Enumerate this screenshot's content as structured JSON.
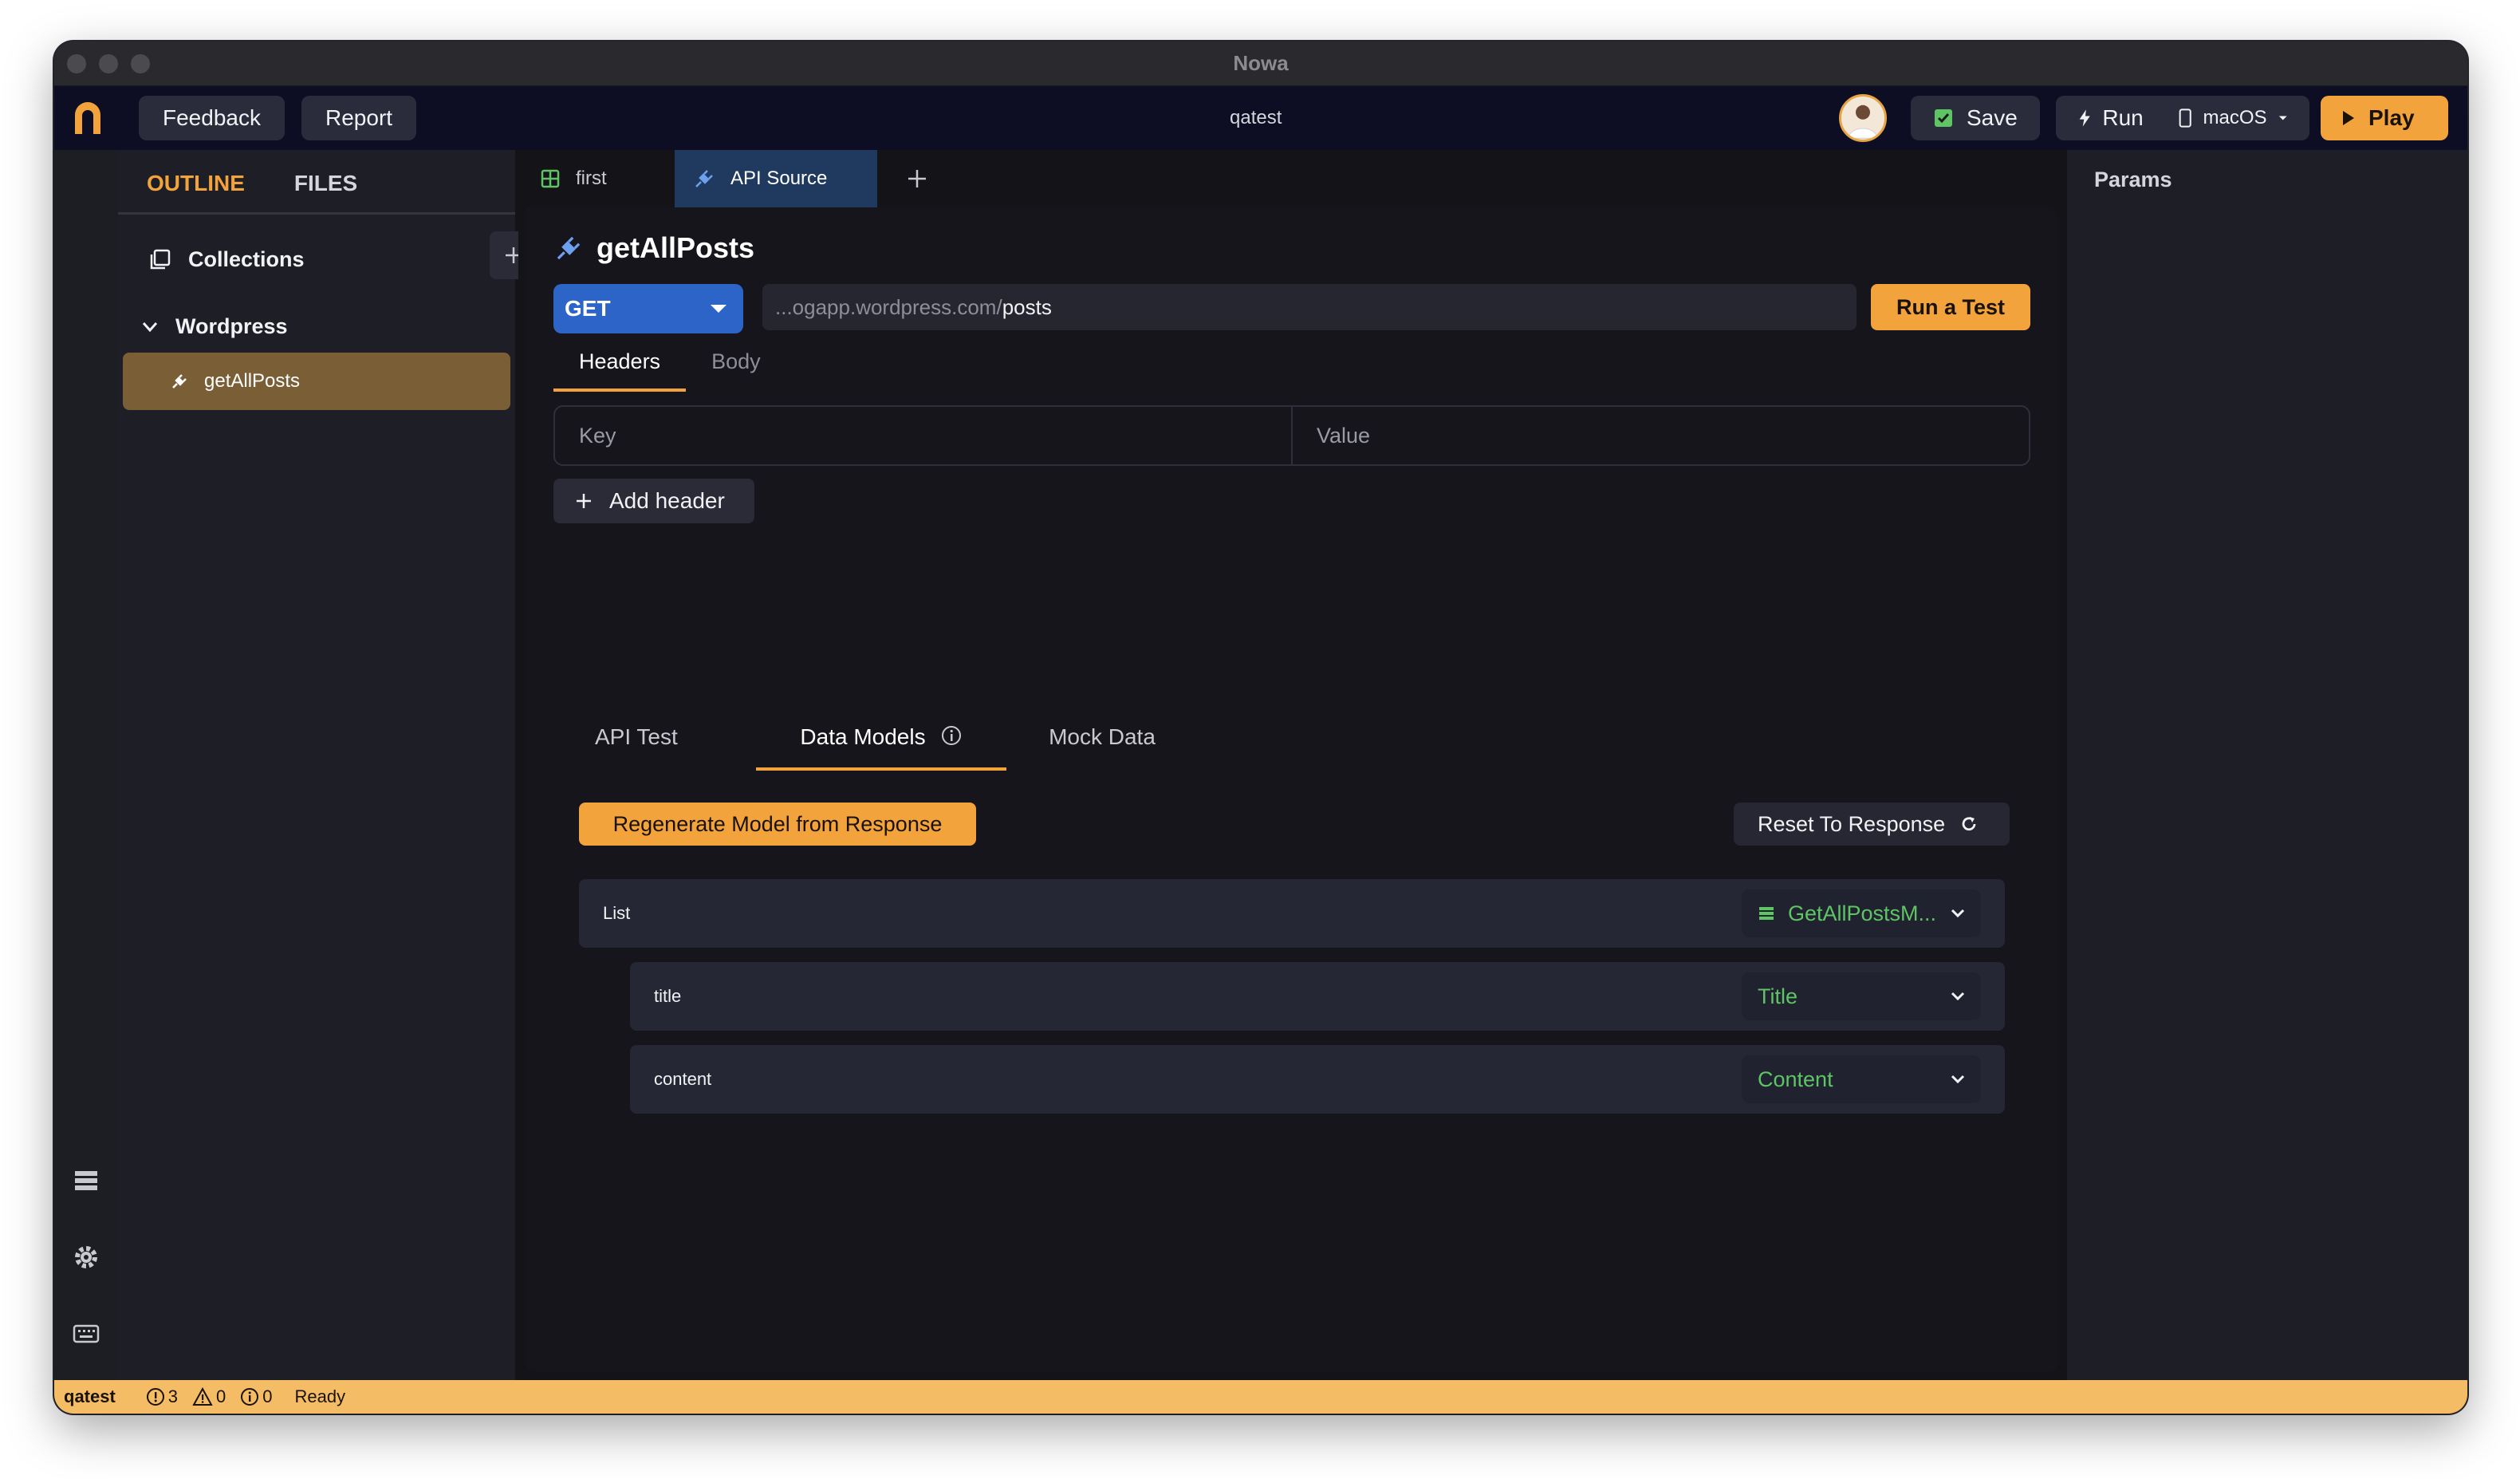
{
  "window": {
    "title": "Nowa"
  },
  "topbar": {
    "feedback_label": "Feedback",
    "report_label": "Report",
    "project_name": "qatest",
    "save_label": "Save",
    "run_label": "Run",
    "platform_label": "macOS",
    "play_label": "Play"
  },
  "sidebar": {
    "tabs": [
      "OUTLINE",
      "FILES"
    ],
    "collections_label": "Collections",
    "group_label": "Wordpress",
    "selected_item": "getAllPosts"
  },
  "editor_tabs": [
    {
      "label": "first",
      "icon": "grid-icon"
    },
    {
      "label": "API Source",
      "icon": "plug-icon"
    }
  ],
  "api": {
    "name": "getAllPosts",
    "method": "GET",
    "url_prefix": "...ogapp.wordpress.com/",
    "url_path": "posts",
    "run_test_label": "Run a Test",
    "request_tabs": [
      "Headers",
      "Body"
    ],
    "table_headers": [
      "Key",
      "Value"
    ],
    "add_header_label": "Add header"
  },
  "lower": {
    "tabs": [
      "API Test",
      "Data Models",
      "Mock Data"
    ],
    "regen_label": "Regenerate Model from Response",
    "reset_label": "Reset To Response",
    "rows": [
      {
        "name": "List",
        "type": "GetAllPostsM..."
      },
      {
        "name": "title",
        "type": "Title"
      },
      {
        "name": "content",
        "type": "Content"
      }
    ]
  },
  "right_panel": {
    "title": "Params"
  },
  "statusbar": {
    "project": "qatest",
    "errors": "3",
    "warnings": "0",
    "infos": "0",
    "state": "Ready"
  },
  "colors": {
    "accent": "#f2a33c",
    "method": "#2d64c8",
    "type_green": "#5ec464",
    "status_bg": "#f5bc66"
  }
}
